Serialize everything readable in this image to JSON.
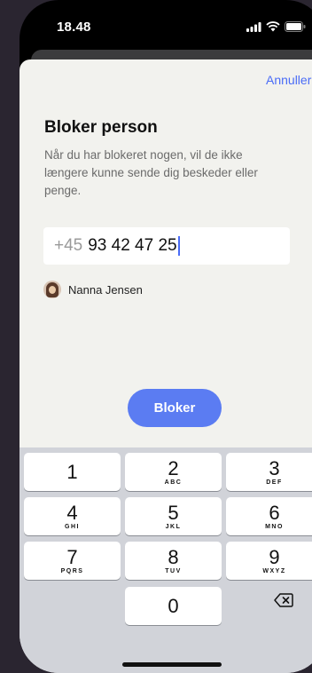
{
  "status_bar": {
    "time": "18.48"
  },
  "sheet": {
    "cancel_label": "Annuller",
    "title": "Bloker person",
    "description": "Når du har blokeret nogen, vil de ikke længere kunne sende dig beskeder eller penge.",
    "phone_input": {
      "prefix": "+45",
      "value": "93 42 47 25"
    },
    "contact": {
      "name": "Nanna Jensen"
    },
    "block_button": "Bloker"
  },
  "keyboard": {
    "keys": [
      {
        "digit": "1",
        "letters": ""
      },
      {
        "digit": "2",
        "letters": "ABC"
      },
      {
        "digit": "3",
        "letters": "DEF"
      },
      {
        "digit": "4",
        "letters": "GHI"
      },
      {
        "digit": "5",
        "letters": "JKL"
      },
      {
        "digit": "6",
        "letters": "MNO"
      },
      {
        "digit": "7",
        "letters": "PQRS"
      },
      {
        "digit": "8",
        "letters": "TUV"
      },
      {
        "digit": "9",
        "letters": "WXYZ"
      },
      {
        "digit": "0",
        "letters": ""
      }
    ],
    "delete_icon": "backspace-icon"
  },
  "colors": {
    "accent": "#5b7cf2",
    "link": "#4a6cf7",
    "sheet_bg": "#f2f2ee"
  }
}
